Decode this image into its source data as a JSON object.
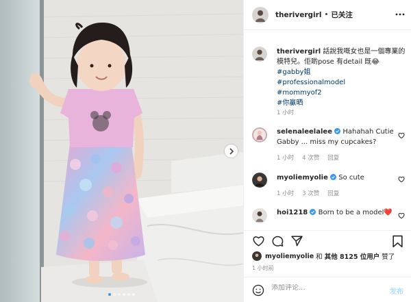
{
  "post": {
    "username": "therivergirl",
    "separator": "•",
    "follow_status": "已关注",
    "image_description_icon": "photo-of-girl-in-sequin-skirt"
  },
  "caption": {
    "username": "therivergirl",
    "text": "話說我嘅女也是一個專業的模特兒。佢啲pose 有detail 既",
    "emoji": "😂",
    "hashtags": [
      "#gabby姐",
      "#professionalmodel",
      "#mommyof2",
      "#你贏晒"
    ],
    "time": "1 小时"
  },
  "comments": [
    {
      "username": "selenaleelalee",
      "verified": true,
      "text": "Hahahah Cutie Gabby ... miss my cupcakes?",
      "time": "1 小时",
      "likes": "4 次赞",
      "reply": "回复"
    },
    {
      "username": "myoliemyolie",
      "verified": true,
      "text": "So cute",
      "time": "1 小时",
      "likes": "3 次赞",
      "reply": "回复"
    },
    {
      "username": "hoi1218",
      "verified": true,
      "text": "Born to be a model",
      "heart": "❤️"
    }
  ],
  "likes_line": {
    "liker": "myoliemyolie",
    "middle": " 和 ",
    "others": "其他 8125 位用户",
    "suffix": " 赞了"
  },
  "posted_ago": "1 小时前",
  "add_comment": {
    "placeholder": "添加评论...",
    "post_label": "发布"
  },
  "colors": {
    "accent": "#3897f0",
    "link": "#00376b",
    "muted": "#8e8e8e",
    "post_disabled": "#b2dffc",
    "verified": "#3897f0"
  }
}
